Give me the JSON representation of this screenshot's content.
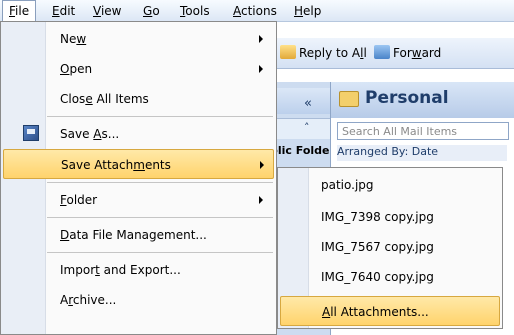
{
  "menubar": {
    "items": [
      {
        "label": "File"
      },
      {
        "label": "Edit"
      },
      {
        "label": "View"
      },
      {
        "label": "Go"
      },
      {
        "label": "Tools"
      },
      {
        "label": "Actions"
      },
      {
        "label": "Help"
      }
    ]
  },
  "toolbar": {
    "reply_all": "Reply to All",
    "forward": "Forward"
  },
  "left_pane": {
    "collapse_glyph": "«",
    "expand_glyph": "˄",
    "public_folders": "blic Folde"
  },
  "right_pane": {
    "title": "Personal",
    "search_placeholder": "Search All Mail Items",
    "arranged_by": "Arranged By: Date"
  },
  "file_menu": {
    "items": [
      {
        "label": "New",
        "has_submenu": true
      },
      {
        "label": "Open",
        "has_submenu": true
      },
      {
        "label": "Close All Items"
      },
      {
        "label": "Save As..."
      },
      {
        "label": "Save Attachments",
        "has_submenu": true,
        "highlighted": true
      },
      {
        "label": "Folder",
        "has_submenu": true
      },
      {
        "label": "Data File Management..."
      },
      {
        "label": "Import and Export..."
      },
      {
        "label": "Archive..."
      }
    ]
  },
  "attachments_submenu": {
    "items": [
      {
        "label": "patio.jpg"
      },
      {
        "label": "IMG_7398 copy.jpg"
      },
      {
        "label": "IMG_7567 copy.jpg"
      },
      {
        "label": "IMG_7640 copy.jpg"
      },
      {
        "label": "All Attachments...",
        "highlighted": true
      }
    ]
  },
  "colors": {
    "highlight": "#ffd36c",
    "menubar": "#dce7f5",
    "gutter": "#e9eef6"
  }
}
